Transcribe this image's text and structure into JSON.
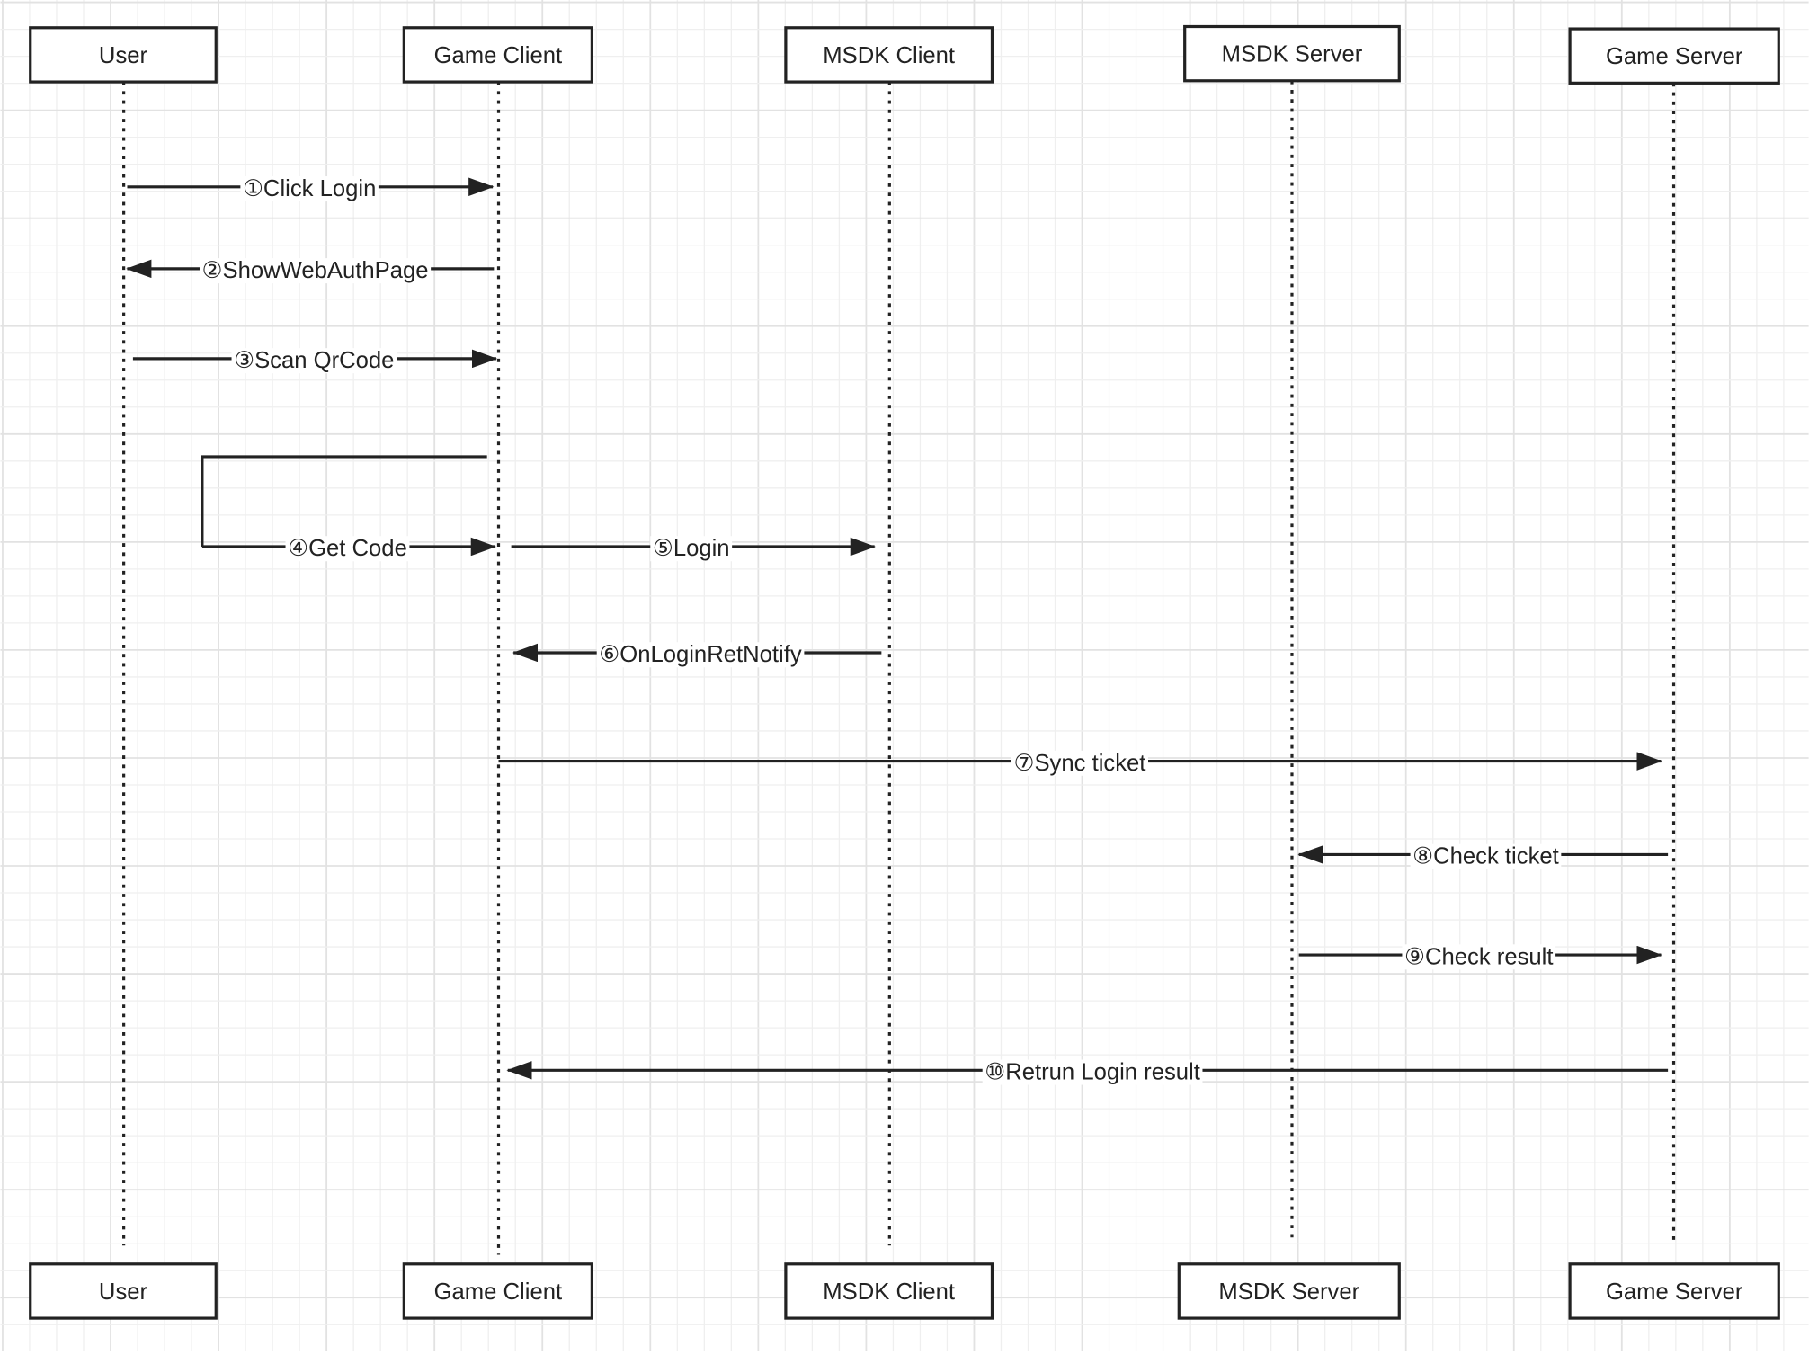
{
  "diagram": {
    "type": "sequence-diagram",
    "colors": {
      "line": "#222222",
      "box_fill": "#ffffff",
      "grid_minor": "#efefef",
      "grid_major": "#e2e2e2",
      "background": "#ffffff"
    },
    "participants": [
      {
        "id": "user",
        "label": "User"
      },
      {
        "id": "game-client",
        "label": "Game Client"
      },
      {
        "id": "msdk-client",
        "label": "MSDK Client"
      },
      {
        "id": "msdk-server",
        "label": "MSDK Server"
      },
      {
        "id": "game-server",
        "label": "Game Server"
      }
    ],
    "messages": [
      {
        "step": 1,
        "label": "①Click Login",
        "from": "user",
        "to": "game-client"
      },
      {
        "step": 2,
        "label": "②ShowWebAuthPage",
        "from": "game-client",
        "to": "user"
      },
      {
        "step": 3,
        "label": "③Scan QrCode",
        "from": "user",
        "to": "game-client"
      },
      {
        "step": 4,
        "label": "④Get Code",
        "from": "game-client",
        "to": "game-client",
        "self": true
      },
      {
        "step": 5,
        "label": "⑤Login",
        "from": "game-client",
        "to": "msdk-client"
      },
      {
        "step": 6,
        "label": "⑥OnLoginRetNotify",
        "from": "msdk-client",
        "to": "game-client"
      },
      {
        "step": 7,
        "label": "⑦Sync ticket",
        "from": "game-client",
        "to": "game-server"
      },
      {
        "step": 8,
        "label": "⑧Check ticket",
        "from": "game-server",
        "to": "msdk-server"
      },
      {
        "step": 9,
        "label": "⑨Check result",
        "from": "msdk-server",
        "to": "game-server"
      },
      {
        "step": 10,
        "label": "⑩Retrun Login result",
        "from": "game-server",
        "to": "game-client"
      }
    ]
  }
}
